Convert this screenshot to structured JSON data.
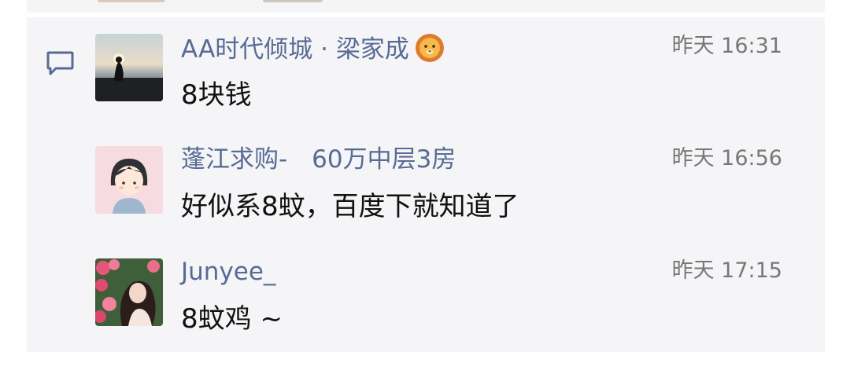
{
  "comments": [
    {
      "author": "AA时代倾城 · 梁家成",
      "author_emoji": "lion-face",
      "time": "昨天 16:31",
      "text": "8块钱"
    },
    {
      "author": "蓬江求购-　60万中层3房",
      "time": "昨天 16:56",
      "text": "好似系8蚊，百度下就知道了"
    },
    {
      "author": "Junyee_",
      "time": "昨天 17:15",
      "text": "8蚊鸡 ~"
    }
  ],
  "icons": {
    "comment": "comment-bubble-icon",
    "emoji": "lion-emoji-icon"
  },
  "colors": {
    "name_link": "#576b95",
    "panel_bg": "#f5f5f7",
    "time_text": "#777777",
    "body_text": "#111111"
  }
}
